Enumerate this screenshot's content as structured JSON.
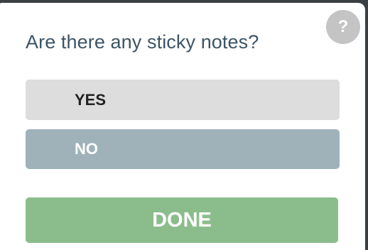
{
  "dialog": {
    "question": "Are there any sticky notes?",
    "help_icon_glyph": "?",
    "options": [
      {
        "label": "YES",
        "state": "unselected"
      },
      {
        "label": "NO",
        "state": "selected"
      }
    ],
    "done_label": "DONE"
  },
  "colors": {
    "question_text": "#3d5466",
    "yes_background": "#dddddd",
    "no_background_selected": "#9fb2ba",
    "done_background": "#8bbd8c",
    "help_icon_background": "#c4c4c4"
  },
  "icons": {
    "help": "help-question-icon"
  }
}
